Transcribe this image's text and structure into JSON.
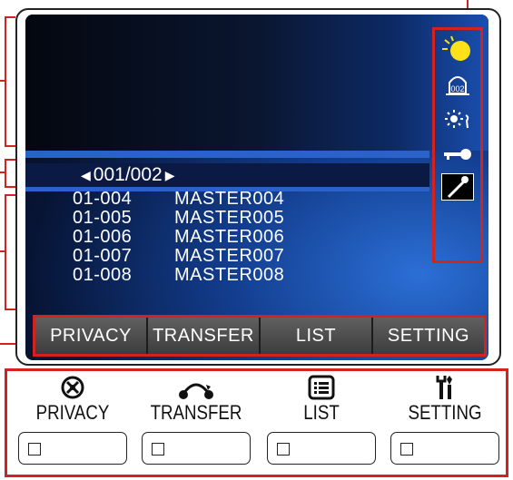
{
  "pagination": {
    "prev_arrow": "◀",
    "page": "001/002",
    "next_arrow": "▶"
  },
  "list": [
    {
      "number": "01-004",
      "name": "MASTER004"
    },
    {
      "number": "01-005",
      "name": "MASTER005"
    },
    {
      "number": "01-006",
      "name": "MASTER006"
    },
    {
      "number": "01-007",
      "name": "MASTER007"
    },
    {
      "number": "01-008",
      "name": "MASTER008"
    }
  ],
  "status_icons": [
    "day-night-icon",
    "station-002-icon",
    "brightness-icon",
    "key-icon",
    "mic-icon"
  ],
  "status_text": {
    "station": "002"
  },
  "softkeys": [
    "PRIVACY",
    "TRANSFER",
    "LIST",
    "SETTING"
  ],
  "buttons": [
    {
      "label": "PRIVACY",
      "icon": "privacy-icon"
    },
    {
      "label": "TRANSFER",
      "icon": "transfer-icon"
    },
    {
      "label": "LIST",
      "icon": "list-icon"
    },
    {
      "label": "SETTING",
      "icon": "setting-icon"
    }
  ],
  "colors": {
    "callout": "#d4231f",
    "screen_bar": "#2a62c9"
  }
}
